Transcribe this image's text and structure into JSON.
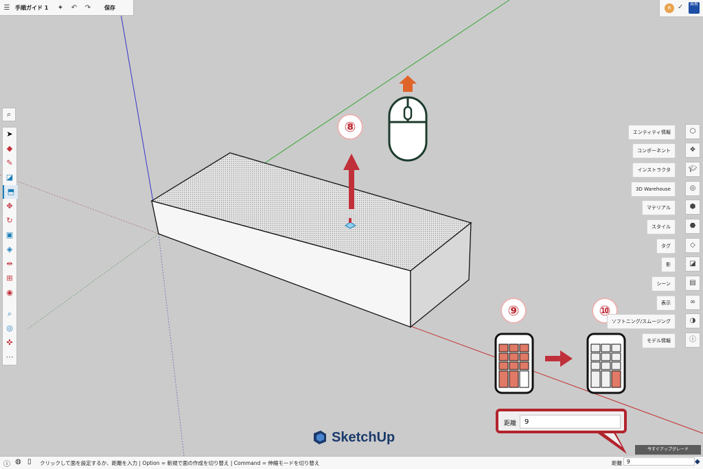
{
  "top_bar": {
    "menu_icon": "hamburger-icon",
    "title": "手順ガイド 1",
    "sparkle_icon": "sparkle-icon",
    "undo_icon": "undo-icon",
    "redo_icon": "redo-icon",
    "save_label": "保存"
  },
  "top_right": {
    "avatar_initial": "R",
    "share_label": "共有"
  },
  "left_tools": [
    "select",
    "eraser",
    "pencil",
    "rectangle",
    "push-pull",
    "move",
    "rotate",
    "scale",
    "paint-bucket",
    "tape-measure",
    "section-plane",
    "walk",
    "zoom",
    "orbit",
    "position-camera",
    "more"
  ],
  "right_panels": [
    {
      "label": "エンティティ情報",
      "icon": "cube-icon"
    },
    {
      "label": "コンポーネント",
      "icon": "components-icon"
    },
    {
      "label": "インストラクタ",
      "icon": "instructor-icon"
    },
    {
      "label": "3D Warehouse",
      "icon": "warehouse-icon"
    },
    {
      "label": "マテリアル",
      "icon": "material-icon"
    },
    {
      "label": "スタイル",
      "icon": "style-icon"
    },
    {
      "label": "タグ",
      "icon": "tag-icon"
    },
    {
      "label": "影",
      "icon": "shadow-icon"
    },
    {
      "label": "シーン",
      "icon": "scene-icon"
    },
    {
      "label": "表示",
      "icon": "display-icon"
    },
    {
      "label": "ソフトニング/スムージング",
      "icon": "smoothing-icon"
    },
    {
      "label": "モデル情報",
      "icon": "info-icon"
    }
  ],
  "guide": {
    "step8": "⑧",
    "step9": "⑨",
    "step10": "⑩",
    "callout_label": "距離",
    "callout_value": "9"
  },
  "logo_text": "SketchUp",
  "upgrade_label": "今すぐアップグレード",
  "status": {
    "text": "クリックして面を設定するか、距離を入力 | Option = 新規で面の作成を切り替え | Command = 伸縮モードを切り替え",
    "measure_label": "距離",
    "measure_value": "9"
  }
}
